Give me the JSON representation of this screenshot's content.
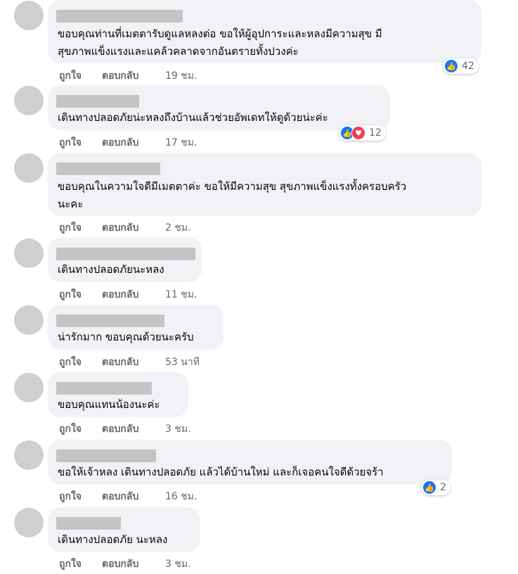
{
  "colors": {
    "bubble": "#f0f2f5",
    "like": "#1877f2",
    "love": "#f33e58",
    "meta": "#65676b"
  },
  "actions": {
    "like_label": "ถูกใจ",
    "reply_label": "ตอบกลับ"
  },
  "comments": [
    {
      "text": "ขอบคุณท่านที่เมตตารับดูแลหลงต่อ ขอให้ผู้อุปการะและหลงมีความสุข มี\nสุขภาพแข็งแรงและแคล้วคลาดจากอันตรายทั้งปวงค่ะ",
      "time": "19 ชม.",
      "reactions": {
        "icons": [
          "like-icon"
        ],
        "count": "42"
      }
    },
    {
      "text": "เดินทางปลอดภัยน่ะหลงถึงบ้านแล้วช่วยอัพเดทให้ดูด้วยน่ะค่ะ",
      "time": "17 ชม.",
      "reactions": {
        "icons": [
          "like-icon",
          "love-icon"
        ],
        "count": "12"
      }
    },
    {
      "text": "ขอบคุณในความใจดีมีเมตตาค่ะ ขอให้มีความสุข สุขภาพแข็งแรงทั้งครอบครัว\nนะคะ",
      "time": "2 ชม."
    },
    {
      "text": "เดินทางปลอดภัยนะหลง",
      "time": "11 ชม."
    },
    {
      "text": "น่ารักมาก ขอบคุณด้วยนะครับ",
      "time": "53 นาที"
    },
    {
      "text": "ขอบคุณแทนน้องนะค่ะ",
      "time": "3 ชม."
    },
    {
      "text": "ขอให้เจ้าหลง เดินทางปลอดภัย แล้วได้บ้านใหม่ และก็เจอคนใจดีด้วยจร้า",
      "time": "16 ชม.",
      "reactions": {
        "icons": [
          "like-icon"
        ],
        "count": "2"
      }
    },
    {
      "text": "เดินทางปลอดภัย นะหลง",
      "time": "3 ชม."
    }
  ]
}
